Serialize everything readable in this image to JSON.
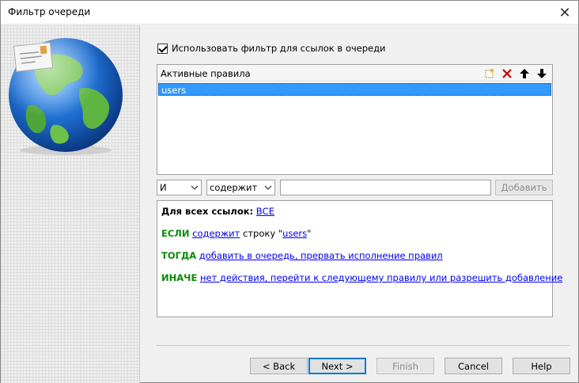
{
  "window": {
    "title": "Фильтр очереди",
    "close_glyph": "✕"
  },
  "filter": {
    "use_filter_label": "Использовать фильтр для ссылок в очереди",
    "use_filter_checked": true
  },
  "rules": {
    "header": "Активные правила",
    "tools": [
      "new-rule-icon",
      "delete-icon",
      "move-up-icon",
      "move-down-icon"
    ],
    "items": [
      "users"
    ],
    "selected_index": 0
  },
  "editor": {
    "logic_value": "И",
    "condition_value": "содержит",
    "text_value": "",
    "add_label": "Добавить"
  },
  "description": {
    "for_all_label": "Для всех ссылок:",
    "for_all_link": "ВСЕ",
    "if_kw": "ЕСЛИ",
    "if_cond_link": "содержит",
    "if_text": " строку \"",
    "if_value_link": "users",
    "if_end": "\"",
    "then_kw": "ТОГДА",
    "then_link": "добавить в очередь, прервать исполнение правил",
    "else_kw": "ИНАЧЕ",
    "else_link": "нет действия, перейти к следующему правилу или разрешить добавление"
  },
  "buttons": {
    "back": "< Back",
    "next": "Next >",
    "finish": "Finish",
    "cancel": "Cancel",
    "help": "Help"
  },
  "colors": {
    "selection": "#3399ff",
    "keyword": "#0a8a0a",
    "link": "#0000ee",
    "delete": "#cc0000"
  }
}
